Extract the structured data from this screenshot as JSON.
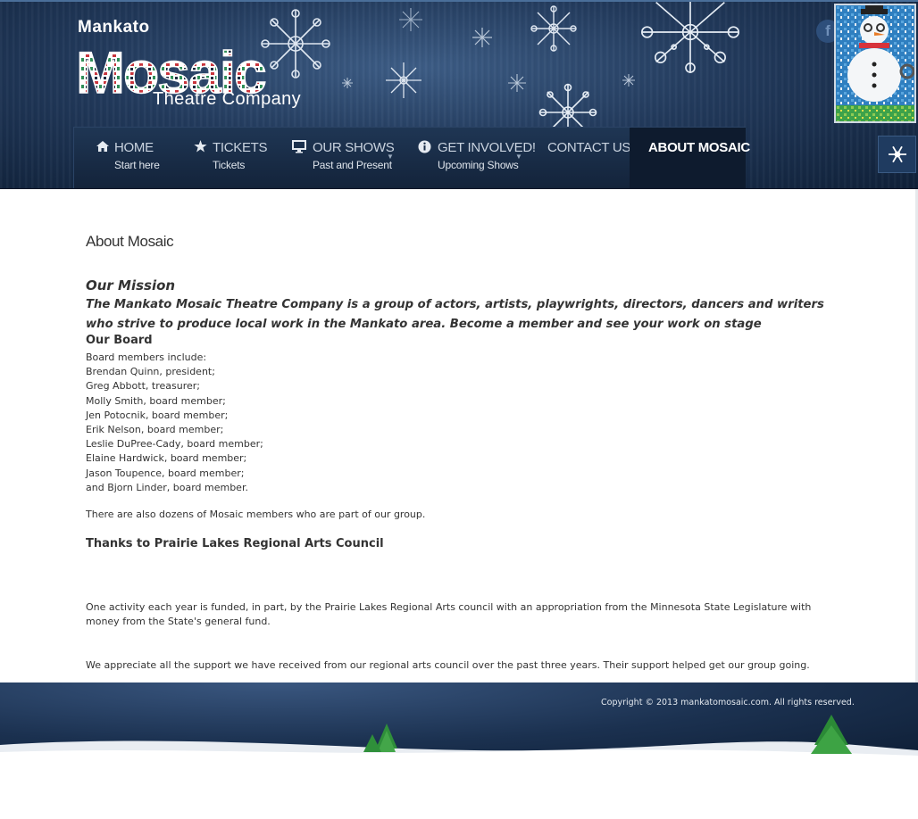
{
  "header": {
    "logo": {
      "top_text": "Mankato",
      "big_text": "Mosaic",
      "bottom_text": "Theatre Company"
    },
    "social_icon": "facebook-icon",
    "mascot_icon": "snowman-mosaic-icon",
    "snow_button_icon": "snowflake-icon"
  },
  "nav": {
    "items": [
      {
        "label": "HOME",
        "sub": "Start here",
        "icon": "home-icon",
        "caret": false
      },
      {
        "label": "TICKETS",
        "sub": "Tickets",
        "icon": "star-icon",
        "caret": false
      },
      {
        "label": "OUR SHOWS",
        "sub": "Past and Present",
        "icon": "monitor-icon",
        "caret": true
      },
      {
        "label": "GET INVOLVED!",
        "sub": "Upcoming Shows",
        "icon": "info-icon",
        "caret": true
      },
      {
        "label": "CONTACT US",
        "sub": "",
        "icon": "",
        "caret": false
      },
      {
        "label": "ABOUT MOSAIC",
        "sub": "",
        "icon": "",
        "caret": false,
        "active": true
      }
    ]
  },
  "main": {
    "page_title": "About Mosaic",
    "mission_heading": "Our Mission",
    "mission_text": "The Mankato Mosaic Theatre Company is a group of actors, artists, playwrights, directors, dancers and writers who strive to produce local work in the Mankato area. Become a member and see your work on stage",
    "board_heading": "Our Board",
    "board_lines": [
      "Board members include:",
      "Brendan Quinn, president;",
      "Greg Abbott, treasurer;",
      "Molly Smith, board member;",
      "Jen Potocnik, board member;",
      "Erik Nelson, board member;",
      "Leslie DuPree-Cady, board member;",
      "Elaine Hardwick, board member;",
      "Jason Toupence, board member;",
      "and Bjorn Linder, board member."
    ],
    "members_note": "There are also dozens of Mosaic members who are part of our group.",
    "thanks_heading": "Thanks to Prairie Lakes Regional Arts Council",
    "funding_text": "One activity each year is funded, in part, by the Prairie Lakes Regional Arts council with an appropriation from the Minnesota State Legislature with money from the State's general fund.",
    "appreciation_text": "We appreciate all the support we have received from our regional arts council over the past three years. Their support helped get our group going."
  },
  "footer": {
    "copyright": "Copyright © 2013 mankatomosaic.com. All rights reserved."
  },
  "colors": {
    "header_dark": "#0f2038",
    "header_mid": "#223a5c",
    "nav_active": "#0e1b2e",
    "text": "#333333"
  }
}
